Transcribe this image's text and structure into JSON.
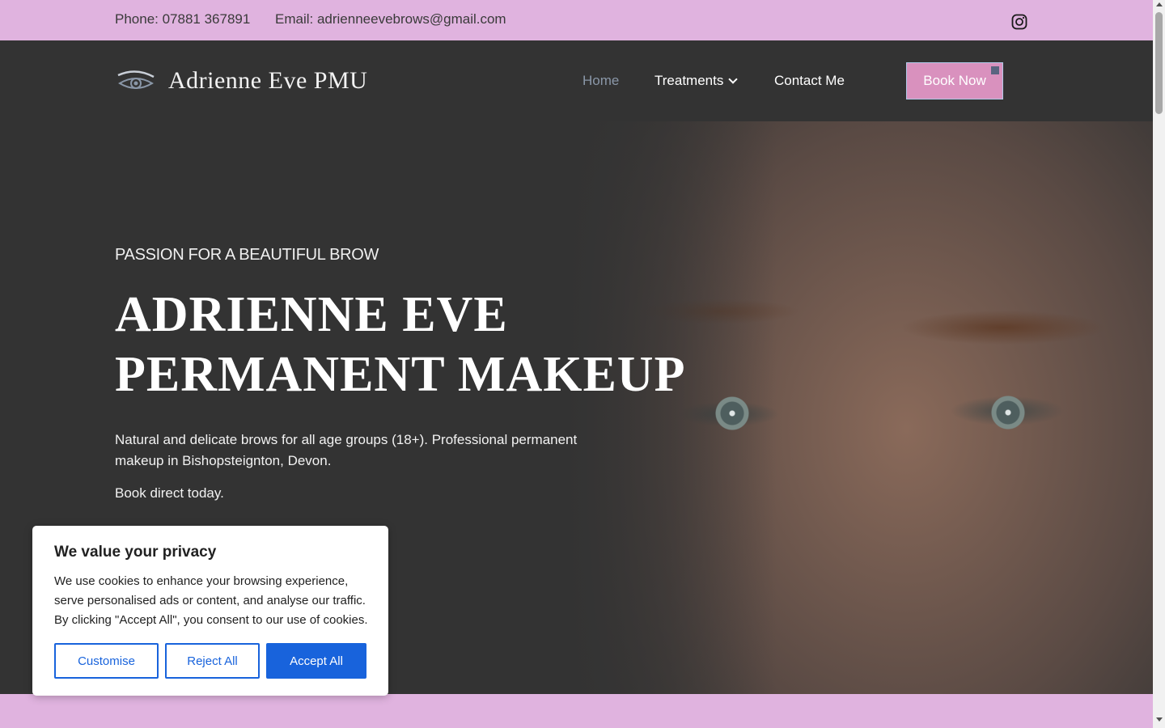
{
  "topbar": {
    "phone": "Phone: 07881 367891",
    "email": "Email: adrienneevebrows@gmail.com",
    "social_icon": "instagram-icon"
  },
  "header": {
    "logo_icon": "eye-icon",
    "logo_text": "Adrienne Eve PMU",
    "nav": {
      "home": "Home",
      "treatments": "Treatments",
      "contact": "Contact Me"
    },
    "book_button": "Book Now"
  },
  "hero": {
    "tagline": "PASSION FOR A BEAUTIFUL BROW",
    "title_line1": "ADRIENNE EVE",
    "title_line2": "PERMANENT MAKEUP",
    "description": "Natural and delicate brows for all age groups (18+). Professional permanent makeup in Bishopsteignton, Devon.",
    "cta_text": "Book direct today."
  },
  "cookie": {
    "title": "We value your privacy",
    "text": "We use cookies to enhance your browsing experience, serve personalised ads or content, and analyse our traffic. By clicking \"Accept All\", you consent to our use of cookies.",
    "customise": "Customise",
    "reject": "Reject All",
    "accept": "Accept All"
  },
  "colors": {
    "topbar": "#e0b3df",
    "header": "#333333",
    "book_button": "#d991be",
    "cookie_accent": "#1863dc"
  }
}
